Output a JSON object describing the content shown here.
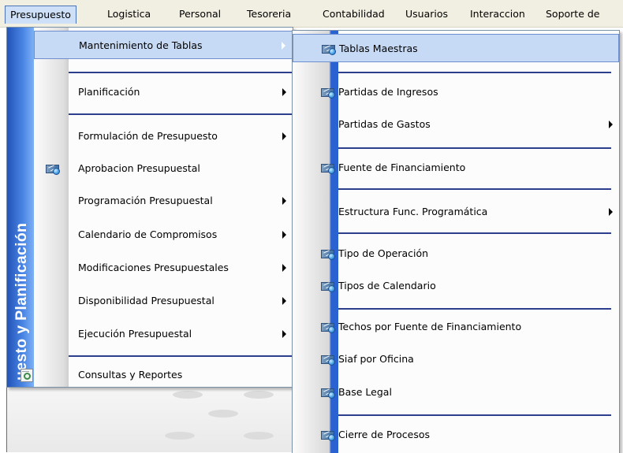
{
  "menubar": {
    "items": [
      "Presupuesto",
      "Logistica",
      "Personal",
      "Tesoreria",
      "Contabilidad",
      "Usuarios",
      "Interaccion",
      "Soporte de"
    ],
    "active_index": 0
  },
  "sidebar": {
    "text": "uesto y Planificación"
  },
  "menu1": {
    "items": [
      {
        "label": "Mantenimiento de Tablas",
        "submenu": true,
        "highlighted": true,
        "icon": "none"
      },
      {
        "label": "Planificación",
        "submenu": true,
        "icon": "none"
      },
      {
        "label": "Formulación de Presupuesto",
        "submenu": true,
        "icon": "none"
      },
      {
        "label": "Aprobacion Presupuestal",
        "submenu": false,
        "icon": "form-icon"
      },
      {
        "label": "Programación Presupuestal",
        "submenu": true,
        "icon": "none"
      },
      {
        "label": "Calendario de Compromisos",
        "submenu": true,
        "icon": "none"
      },
      {
        "label": "Modificaciones Presupuestales",
        "submenu": true,
        "icon": "none"
      },
      {
        "label": "Disponibilidad Presupuestal",
        "submenu": true,
        "icon": "none"
      },
      {
        "label": "Ejecución Presupuestal",
        "submenu": true,
        "icon": "none"
      },
      {
        "label": "Consultas y Reportes",
        "submenu": false,
        "icon": "report-icon"
      }
    ]
  },
  "menu2": {
    "items": [
      {
        "label": "Tablas Maestras",
        "submenu": false,
        "highlighted": true,
        "icon": "form-icon"
      },
      {
        "label": "Partidas de Ingresos",
        "submenu": false,
        "icon": "form-icon"
      },
      {
        "label": "Partidas de Gastos",
        "submenu": true,
        "icon": "none"
      },
      {
        "label": "Fuente de Financiamiento",
        "submenu": false,
        "icon": "form-icon"
      },
      {
        "label": "Estructura Func. Programática",
        "submenu": true,
        "icon": "none"
      },
      {
        "label": "Tipo de Operación",
        "submenu": false,
        "icon": "form-icon"
      },
      {
        "label": "Tipos de Calendario",
        "submenu": false,
        "icon": "form-icon"
      },
      {
        "label": "Techos por Fuente de Financiamiento",
        "submenu": false,
        "icon": "form-icon"
      },
      {
        "label": "Siaf por Oficina",
        "submenu": false,
        "icon": "form-icon"
      },
      {
        "label": "Base Legal",
        "submenu": false,
        "icon": "form-icon"
      },
      {
        "label": "Cierre de Procesos",
        "submenu": false,
        "icon": "form-icon"
      }
    ]
  },
  "colors": {
    "highlight": "#c7daf5",
    "separator": "#2c3e8c",
    "sidebar": "#2a63d1"
  }
}
